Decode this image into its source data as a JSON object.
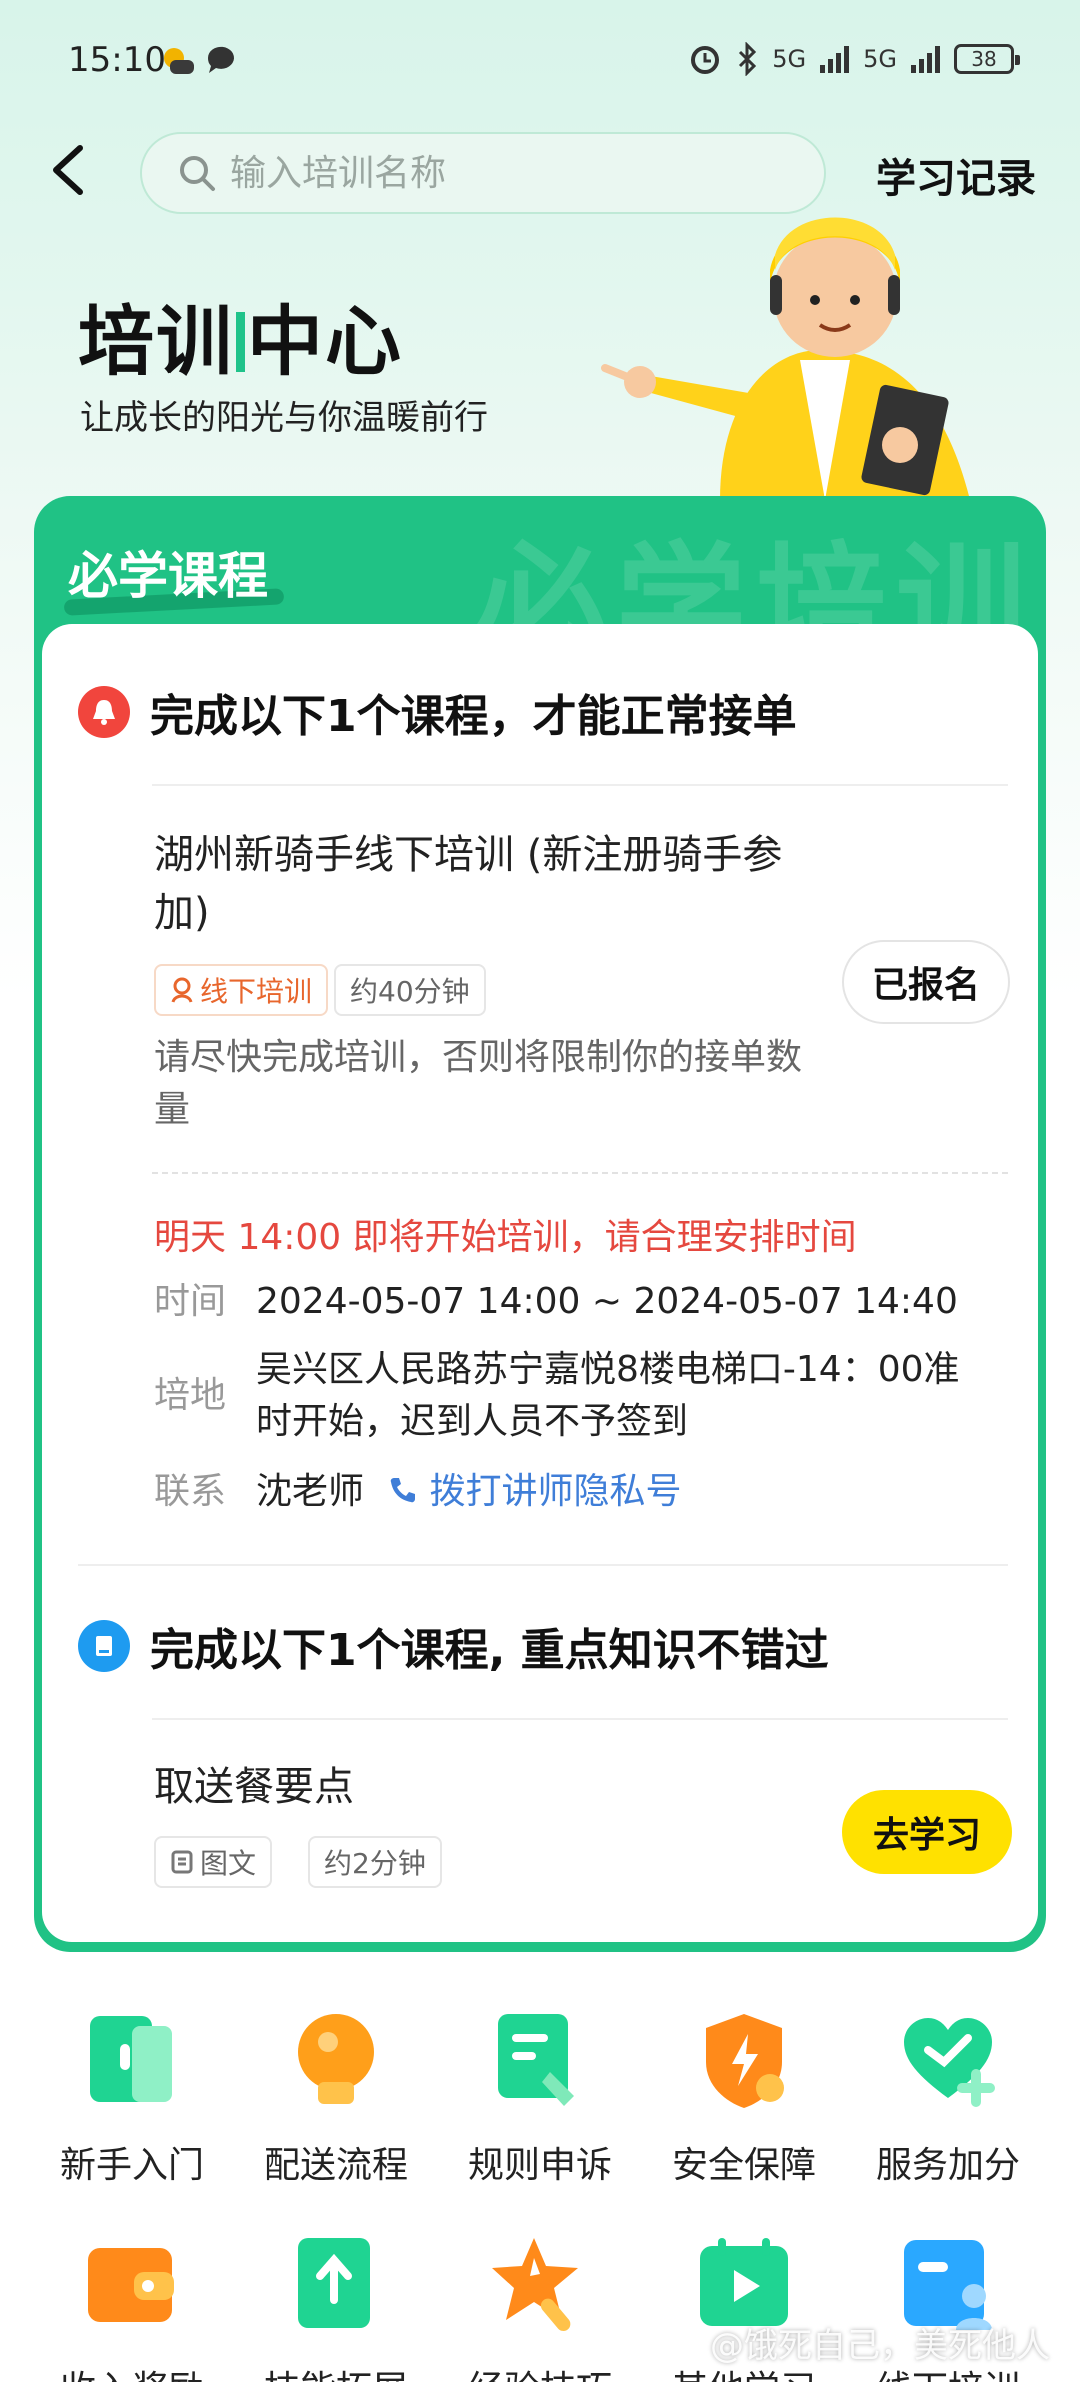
{
  "status_bar": {
    "time": "15:10",
    "battery": "38",
    "net_left": "5G",
    "net_right": "5G"
  },
  "header": {
    "search_placeholder": "输入培训名称",
    "history_label": "学习记录"
  },
  "hero": {
    "title_a": "培训",
    "title_b": "中心",
    "subtitle": "让成长的阳光与你温暖前行"
  },
  "card": {
    "title": "必学课程",
    "watermark": "必学培训",
    "section1": {
      "heading": "完成以下1个课程，才能正常接单",
      "course": {
        "title": "湖州新骑手线下培训 (新注册骑手参加)",
        "tag_type": "线下培训",
        "tag_duration": "约40分钟",
        "button": "已报名",
        "note": "请尽快完成培训，否则将限制你的接单数量",
        "warning": "明天 14:00 即将开始培训，请合理安排时间",
        "time_key": "时间",
        "time_value": "2024-05-07 14:00 ~ 2024-05-07 14:40",
        "place_key": "培地",
        "place_value": "吴兴区人民路苏宁嘉悦8楼电梯口-14：00准时开始，迟到人员不予签到",
        "contact_key": "联系",
        "contact_value": "沈老师",
        "call_label": "拨打讲师隐私号"
      }
    },
    "section2": {
      "heading": "完成以下1个课程, 重点知识不错过",
      "course": {
        "title": "取送餐要点",
        "tag_type": "图文",
        "tag_duration": "约2分钟",
        "button": "去学习"
      }
    }
  },
  "grid": [
    {
      "label": "新手入门",
      "icon": "newbie-icon",
      "color": "#1fd492"
    },
    {
      "label": "配送流程",
      "icon": "lightbulb-icon",
      "color": "#ff9f1a"
    },
    {
      "label": "规则申诉",
      "icon": "document-pen-icon",
      "color": "#1fd492"
    },
    {
      "label": "安全保障",
      "icon": "shield-icon",
      "color": "#ff8a1a"
    },
    {
      "label": "服务加分",
      "icon": "heart-plus-icon",
      "color": "#1fd492"
    },
    {
      "label": "收入奖励",
      "icon": "wallet-icon",
      "color": "#ff8a1a"
    },
    {
      "label": "技能拓展",
      "icon": "book-arrow-icon",
      "color": "#1fd492"
    },
    {
      "label": "经验技巧",
      "icon": "star-icon",
      "color": "#ff8a1a"
    },
    {
      "label": "其他学习",
      "icon": "video-icon",
      "color": "#1fd492"
    },
    {
      "label": "线下培训",
      "icon": "person-book-icon",
      "color": "#2aa8ff"
    }
  ],
  "watermark_text": "@饿死自己，美死他人"
}
